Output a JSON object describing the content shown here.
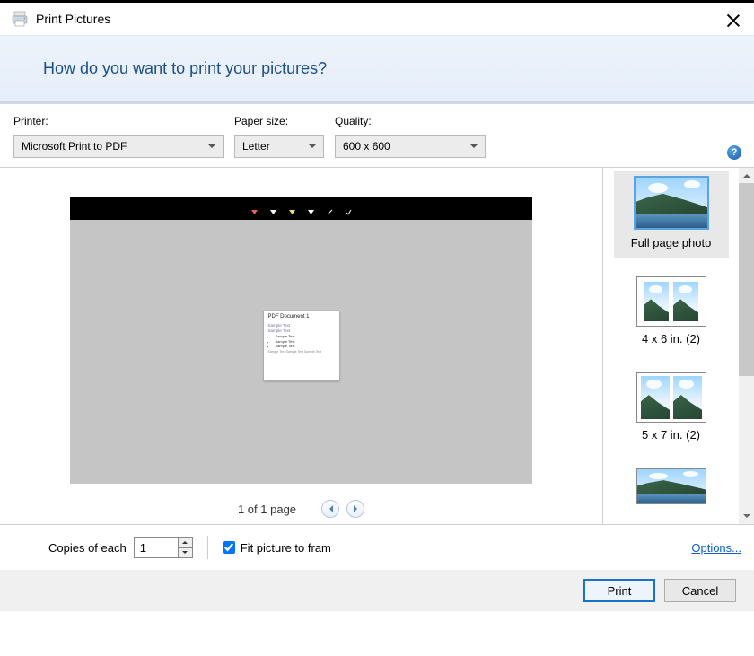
{
  "window": {
    "title": "Print Pictures"
  },
  "header": {
    "question": "How do you want to print your pictures?"
  },
  "dropdowns": {
    "printer": {
      "label": "Printer:",
      "value": "Microsoft Print to PDF"
    },
    "paper": {
      "label": "Paper size:",
      "value": "Letter"
    },
    "quality": {
      "label": "Quality:",
      "value": "600 x 600"
    }
  },
  "preview": {
    "doc_title": "PDF Document 1",
    "line1": "Sample Text",
    "line2": "Sample Text",
    "bullets": [
      "Sample Text",
      "Sample Text",
      "Sample Text"
    ],
    "footer": "Sample Text Sample Text Sample Text"
  },
  "pager": {
    "text": "1 of 1 page"
  },
  "layouts": {
    "items": [
      {
        "label": "Full page photo"
      },
      {
        "label": "4 x 6 in. (2)"
      },
      {
        "label": "5 x 7 in. (2)"
      },
      {
        "label": ""
      }
    ]
  },
  "copies": {
    "label": "Copies of each",
    "value": "1"
  },
  "fit": {
    "label": "Fit picture to fram",
    "checked": true
  },
  "options_link": "Options...",
  "footer": {
    "print": "Print",
    "cancel": "Cancel"
  }
}
